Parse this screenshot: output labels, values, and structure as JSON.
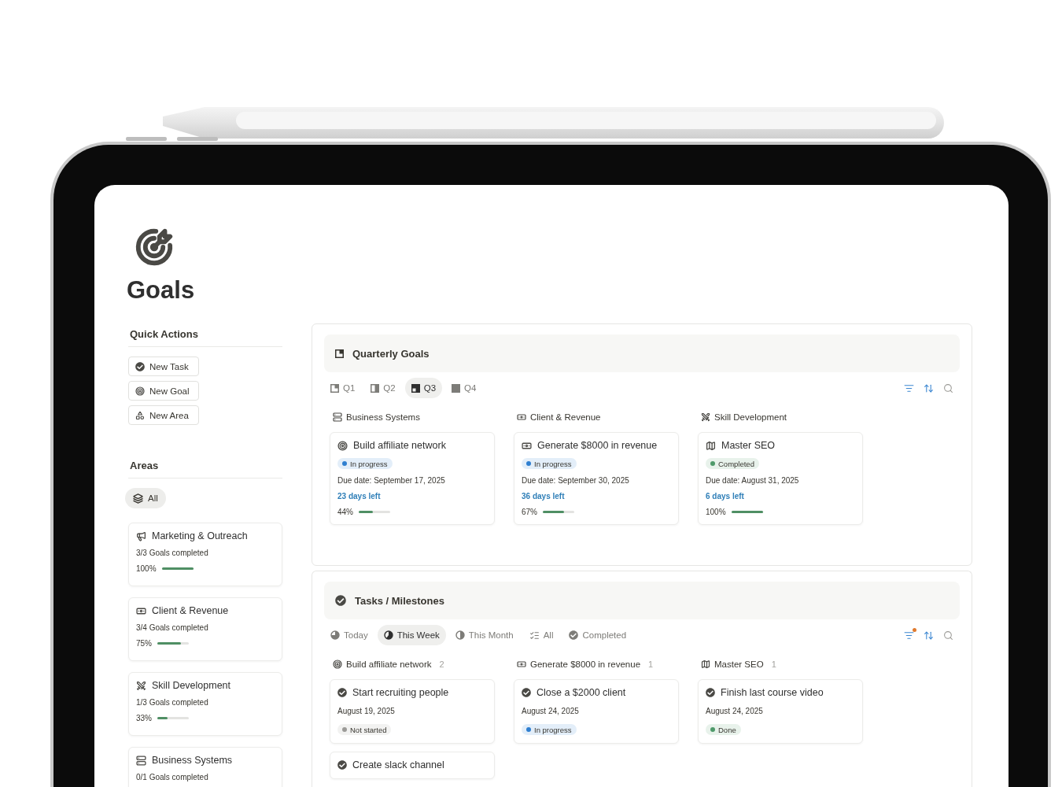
{
  "page": {
    "title": "Goals"
  },
  "quick_actions": {
    "title": "Quick Actions",
    "buttons": [
      {
        "label": "New Task",
        "kind": "task"
      },
      {
        "label": "New Goal",
        "kind": "goal"
      },
      {
        "label": "New Area",
        "kind": "area"
      }
    ]
  },
  "areas": {
    "title": "Areas",
    "filter": {
      "label": "All",
      "selected": true
    },
    "cards": [
      {
        "name": "Marketing & Outreach",
        "kind": "marketing",
        "summary": "3/3 Goals completed",
        "percent": "100%",
        "level": 1
      },
      {
        "name": "Client & Revenue",
        "kind": "client",
        "summary": "3/4 Goals completed",
        "percent": "75%",
        "level": 0.75
      },
      {
        "name": "Skill Development",
        "kind": "skill",
        "summary": "1/3 Goals completed",
        "percent": "33%",
        "level": 0.33
      },
      {
        "name": "Business Systems",
        "kind": "business",
        "summary": "0/1 Goals completed"
      }
    ]
  },
  "quarterly_goals": {
    "title": "Quarterly Goals",
    "tabs": [
      {
        "label": "Q1",
        "selected": false
      },
      {
        "label": "Q2",
        "selected": false
      },
      {
        "label": "Q3",
        "selected": true
      },
      {
        "label": "Q4",
        "selected": false
      }
    ],
    "filter_active": false,
    "columns": [
      {
        "name": "Business Systems",
        "kind": "business",
        "cards": [
          {
            "title": "Build affiliate network",
            "kind": "goal",
            "status": {
              "label": "In progress",
              "color": "#2f7fd0"
            },
            "due": "Due date: September 17, 2025",
            "days_left": "23 days left",
            "percent": "44%",
            "level": 0.44
          }
        ]
      },
      {
        "name": "Client & Revenue",
        "kind": "client",
        "cards": [
          {
            "title": "Generate $8000 in revenue",
            "kind": "client",
            "status": {
              "label": "In progress",
              "color": "#2f7fd0"
            },
            "due": "Due date: September 30, 2025",
            "days_left": "36 days left",
            "percent": "67%",
            "level": 0.67
          }
        ]
      },
      {
        "name": "Skill Development",
        "kind": "skill",
        "cards": [
          {
            "title": "Master SEO",
            "kind": "map",
            "status": {
              "label": "Completed",
              "color": "#4f9a6b"
            },
            "due": "Due date: August 31, 2025",
            "days_left": "6 days left",
            "percent": "100%",
            "level": 1
          }
        ]
      }
    ]
  },
  "tasks": {
    "title": "Tasks / Milestones",
    "tabs": [
      {
        "label": "Today",
        "selected": false
      },
      {
        "label": "This Week",
        "selected": true
      },
      {
        "label": "This Month",
        "selected": false
      },
      {
        "label": "All",
        "selected": false
      },
      {
        "label": "Completed",
        "selected": false
      }
    ],
    "filter_active": true,
    "columns": [
      {
        "name": "Build affiliate network",
        "kind": "goal",
        "count": "2",
        "cards": [
          {
            "title": "Start recruiting people",
            "date": "August 19, 2025",
            "status": {
              "label": "Not started",
              "color": "#9b9a97"
            }
          },
          {
            "title": "Create slack channel"
          }
        ]
      },
      {
        "name": "Generate $8000 in revenue",
        "kind": "client",
        "count": "1",
        "cards": [
          {
            "title": "Close a $2000 client",
            "date": "August 24, 2025",
            "status": {
              "label": "In progress",
              "color": "#2f7fd0"
            }
          }
        ]
      },
      {
        "name": "Master SEO",
        "kind": "map",
        "count": "1",
        "cards": [
          {
            "title": "Finish last course video",
            "date": "August 24, 2025",
            "status": {
              "label": "Done",
              "color": "#4f9a6b"
            }
          }
        ]
      }
    ]
  }
}
